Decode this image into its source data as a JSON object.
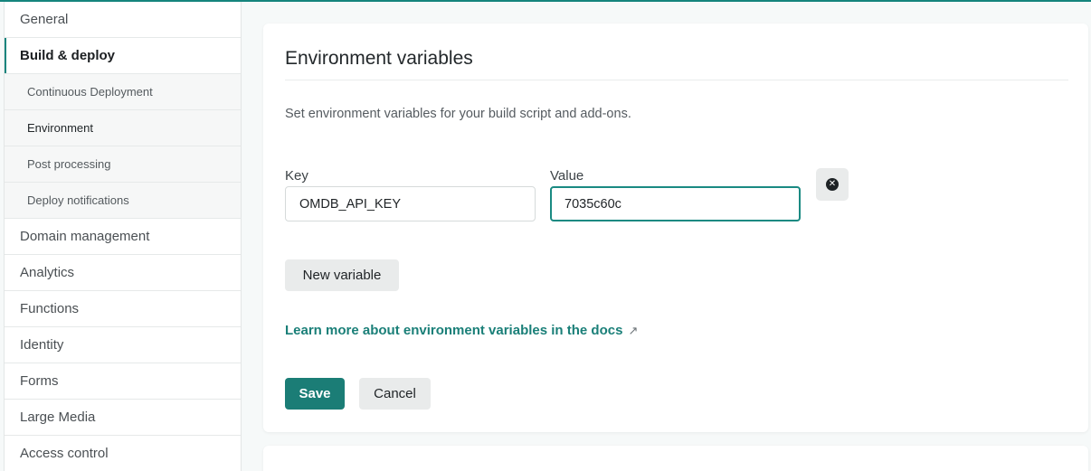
{
  "colors": {
    "accent": "#15847d",
    "primary_button": "#1b7d76",
    "link": "#1a7f78"
  },
  "sidebar": {
    "items": [
      {
        "label": "General"
      },
      {
        "label": "Build & deploy",
        "active": true
      },
      {
        "label": "Continuous Deployment",
        "sub": true
      },
      {
        "label": "Environment",
        "sub": true,
        "current": true
      },
      {
        "label": "Post processing",
        "sub": true
      },
      {
        "label": "Deploy notifications",
        "sub": true
      },
      {
        "label": "Domain management"
      },
      {
        "label": "Analytics"
      },
      {
        "label": "Functions"
      },
      {
        "label": "Identity"
      },
      {
        "label": "Forms"
      },
      {
        "label": "Large Media"
      },
      {
        "label": "Access control"
      }
    ]
  },
  "env_card": {
    "title": "Environment variables",
    "description": "Set environment variables for your build script and add-ons.",
    "key_label": "Key",
    "value_label": "Value",
    "key_value": "OMDB_API_KEY",
    "value_value": "7035c60c",
    "remove_icon": "close-circle-icon",
    "new_variable_label": "New variable",
    "docs_link_label": "Learn more about environment variables in the docs",
    "docs_link_icon": "↗",
    "save_label": "Save",
    "cancel_label": "Cancel"
  }
}
